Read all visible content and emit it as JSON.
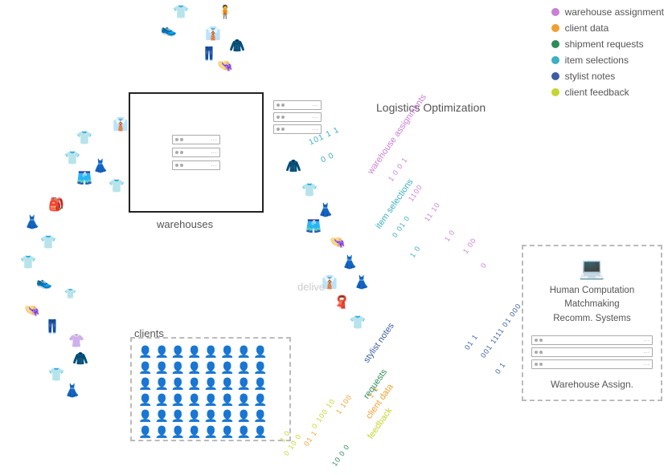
{
  "legend": {
    "items": [
      {
        "id": "warehouse-assignment",
        "label": "warehouse assignment",
        "color": "#c97fd4"
      },
      {
        "id": "client-data",
        "label": "client data",
        "color": "#f0a030"
      },
      {
        "id": "shipment-requests",
        "label": "shipment requests",
        "color": "#2e8b57"
      },
      {
        "id": "item-selections",
        "label": "item selections",
        "color": "#3ab0c0"
      },
      {
        "id": "stylist-notes",
        "label": "stylist notes",
        "color": "#3a5fa0"
      },
      {
        "id": "client-feedback",
        "label": "client feedback",
        "color": "#c8d430"
      }
    ]
  },
  "labels": {
    "warehouses": "warehouses",
    "clients": "clients",
    "logistics_optimization": "Logistics Optimization",
    "human_computation": "Human Computation\nMatchmaking\nRecomm. Systems",
    "warehouse_assign": "Warehouse Assign.",
    "delivery": "delive",
    "warehouse_assignments_diag": "warehouse assignments",
    "item_selections_diag": "item selections",
    "stylist_notes_diag": "stylist notes",
    "requests_diag": "requests",
    "client_data_diag": "client data",
    "feedback_diag": "feedback"
  },
  "binary": {
    "stream1": "101 1 1",
    "stream2": "0 0",
    "stream3": "1 0 0 1",
    "stream4": "1100",
    "stream5": "11 10",
    "stream6": "1 0",
    "stream7": "1 00",
    "stream8": "0",
    "stream9": "0 01 0",
    "stream10": "1 0",
    "stream11": "01 1",
    "stream12": "001 1111 01 000",
    "stream13": "0 1",
    "stream14": "1 1",
    "stream15": "1 100",
    "stream16": "0 100 10",
    "stream17": "1 0",
    "stream18": "01 1",
    "stream19": "0 10 0",
    "stream20": "10 0 0"
  },
  "persons_count": 48
}
